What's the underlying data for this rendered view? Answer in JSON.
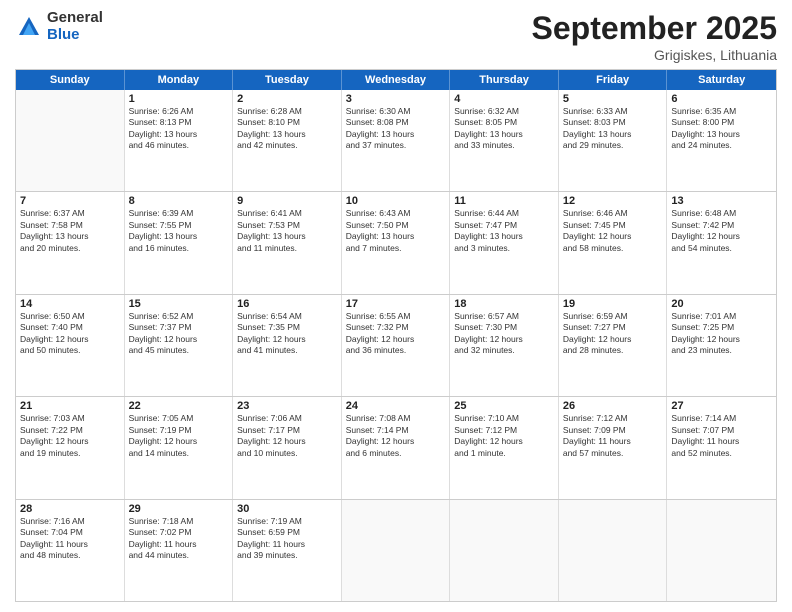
{
  "logo": {
    "general": "General",
    "blue": "Blue"
  },
  "title": "September 2025",
  "subtitle": "Grigiskes, Lithuania",
  "days": [
    "Sunday",
    "Monday",
    "Tuesday",
    "Wednesday",
    "Thursday",
    "Friday",
    "Saturday"
  ],
  "weeks": [
    [
      {
        "day": "",
        "info": ""
      },
      {
        "day": "1",
        "info": "Sunrise: 6:26 AM\nSunset: 8:13 PM\nDaylight: 13 hours\nand 46 minutes."
      },
      {
        "day": "2",
        "info": "Sunrise: 6:28 AM\nSunset: 8:10 PM\nDaylight: 13 hours\nand 42 minutes."
      },
      {
        "day": "3",
        "info": "Sunrise: 6:30 AM\nSunset: 8:08 PM\nDaylight: 13 hours\nand 37 minutes."
      },
      {
        "day": "4",
        "info": "Sunrise: 6:32 AM\nSunset: 8:05 PM\nDaylight: 13 hours\nand 33 minutes."
      },
      {
        "day": "5",
        "info": "Sunrise: 6:33 AM\nSunset: 8:03 PM\nDaylight: 13 hours\nand 29 minutes."
      },
      {
        "day": "6",
        "info": "Sunrise: 6:35 AM\nSunset: 8:00 PM\nDaylight: 13 hours\nand 24 minutes."
      }
    ],
    [
      {
        "day": "7",
        "info": "Sunrise: 6:37 AM\nSunset: 7:58 PM\nDaylight: 13 hours\nand 20 minutes."
      },
      {
        "day": "8",
        "info": "Sunrise: 6:39 AM\nSunset: 7:55 PM\nDaylight: 13 hours\nand 16 minutes."
      },
      {
        "day": "9",
        "info": "Sunrise: 6:41 AM\nSunset: 7:53 PM\nDaylight: 13 hours\nand 11 minutes."
      },
      {
        "day": "10",
        "info": "Sunrise: 6:43 AM\nSunset: 7:50 PM\nDaylight: 13 hours\nand 7 minutes."
      },
      {
        "day": "11",
        "info": "Sunrise: 6:44 AM\nSunset: 7:47 PM\nDaylight: 13 hours\nand 3 minutes."
      },
      {
        "day": "12",
        "info": "Sunrise: 6:46 AM\nSunset: 7:45 PM\nDaylight: 12 hours\nand 58 minutes."
      },
      {
        "day": "13",
        "info": "Sunrise: 6:48 AM\nSunset: 7:42 PM\nDaylight: 12 hours\nand 54 minutes."
      }
    ],
    [
      {
        "day": "14",
        "info": "Sunrise: 6:50 AM\nSunset: 7:40 PM\nDaylight: 12 hours\nand 50 minutes."
      },
      {
        "day": "15",
        "info": "Sunrise: 6:52 AM\nSunset: 7:37 PM\nDaylight: 12 hours\nand 45 minutes."
      },
      {
        "day": "16",
        "info": "Sunrise: 6:54 AM\nSunset: 7:35 PM\nDaylight: 12 hours\nand 41 minutes."
      },
      {
        "day": "17",
        "info": "Sunrise: 6:55 AM\nSunset: 7:32 PM\nDaylight: 12 hours\nand 36 minutes."
      },
      {
        "day": "18",
        "info": "Sunrise: 6:57 AM\nSunset: 7:30 PM\nDaylight: 12 hours\nand 32 minutes."
      },
      {
        "day": "19",
        "info": "Sunrise: 6:59 AM\nSunset: 7:27 PM\nDaylight: 12 hours\nand 28 minutes."
      },
      {
        "day": "20",
        "info": "Sunrise: 7:01 AM\nSunset: 7:25 PM\nDaylight: 12 hours\nand 23 minutes."
      }
    ],
    [
      {
        "day": "21",
        "info": "Sunrise: 7:03 AM\nSunset: 7:22 PM\nDaylight: 12 hours\nand 19 minutes."
      },
      {
        "day": "22",
        "info": "Sunrise: 7:05 AM\nSunset: 7:19 PM\nDaylight: 12 hours\nand 14 minutes."
      },
      {
        "day": "23",
        "info": "Sunrise: 7:06 AM\nSunset: 7:17 PM\nDaylight: 12 hours\nand 10 minutes."
      },
      {
        "day": "24",
        "info": "Sunrise: 7:08 AM\nSunset: 7:14 PM\nDaylight: 12 hours\nand 6 minutes."
      },
      {
        "day": "25",
        "info": "Sunrise: 7:10 AM\nSunset: 7:12 PM\nDaylight: 12 hours\nand 1 minute."
      },
      {
        "day": "26",
        "info": "Sunrise: 7:12 AM\nSunset: 7:09 PM\nDaylight: 11 hours\nand 57 minutes."
      },
      {
        "day": "27",
        "info": "Sunrise: 7:14 AM\nSunset: 7:07 PM\nDaylight: 11 hours\nand 52 minutes."
      }
    ],
    [
      {
        "day": "28",
        "info": "Sunrise: 7:16 AM\nSunset: 7:04 PM\nDaylight: 11 hours\nand 48 minutes."
      },
      {
        "day": "29",
        "info": "Sunrise: 7:18 AM\nSunset: 7:02 PM\nDaylight: 11 hours\nand 44 minutes."
      },
      {
        "day": "30",
        "info": "Sunrise: 7:19 AM\nSunset: 6:59 PM\nDaylight: 11 hours\nand 39 minutes."
      },
      {
        "day": "",
        "info": ""
      },
      {
        "day": "",
        "info": ""
      },
      {
        "day": "",
        "info": ""
      },
      {
        "day": "",
        "info": ""
      }
    ]
  ]
}
